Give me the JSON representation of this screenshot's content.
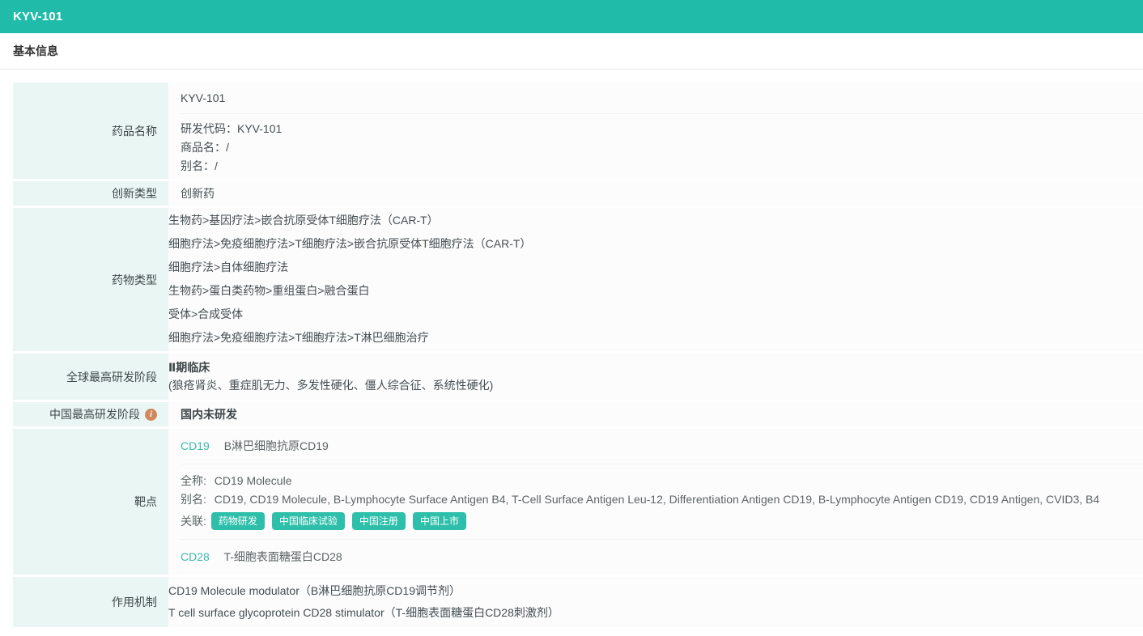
{
  "header": {
    "title": "KYV-101"
  },
  "section": {
    "title": "基本信息"
  },
  "basic_info": {
    "drug_name": {
      "label": "药品名称",
      "primary": "KYV-101",
      "dev_code": "研发代码：KYV-101",
      "trade_name": "商品名：/",
      "alias": "别名：/"
    },
    "innovation_type": {
      "label": "创新类型",
      "value": "创新药"
    },
    "drug_type": {
      "label": "药物类型",
      "lines": [
        "生物药>基因疗法>嵌合抗原受体T细胞疗法（CAR-T）",
        "细胞疗法>免疫细胞疗法>T细胞疗法>嵌合抗原受体T细胞疗法（CAR-T）",
        "细胞疗法>自体细胞疗法",
        "生物药>蛋白类药物>重组蛋白>融合蛋白",
        "受体>合成受体",
        "细胞疗法>免疫细胞疗法>T细胞疗法>T淋巴细胞治疗"
      ]
    },
    "global_stage": {
      "label": "全球最高研发阶段",
      "stage": "Ⅱ期临床",
      "indications": "(狼疮肾炎、重症肌无力、多发性硬化、僵人综合征、系统性硬化)"
    },
    "china_stage": {
      "label": "中国最高研发阶段",
      "info_icon": "i",
      "value": "国内未研发"
    },
    "target": {
      "label": "靶点",
      "targets": [
        {
          "code": "CD19",
          "name": "B淋巴细胞抗原CD19"
        },
        {
          "code": "CD28",
          "name": "T-细胞表面糖蛋白CD28"
        }
      ],
      "detail": {
        "full_name_label": "全称:",
        "full_name": "CD19 Molecule",
        "alias_label": "别名:",
        "alias": "CD19, CD19 Molecule, B-Lymphocyte Surface Antigen B4, T-Cell Surface Antigen Leu-12, Differentiation Antigen CD19, B-Lymphocyte Antigen CD19, CD19 Antigen, CVID3, B4",
        "related_label": "关联:",
        "links": [
          "药物研发",
          "中国临床试验",
          "中国注册",
          "中国上市"
        ]
      }
    },
    "moa": {
      "label": "作用机制",
      "lines": [
        "CD19 Molecule modulator（B淋巴细胞抗原CD19调节剂）",
        "T cell surface glycoprotein CD28 stimulator（T-细胞表面糖蛋白CD28刺激剂）"
      ]
    }
  },
  "colors": {
    "accent": "#20bca9",
    "tag": "#2ebfab",
    "link": "#3bbcab",
    "label_bg": "#eaf6f4",
    "info_icon": "#d0885e"
  }
}
